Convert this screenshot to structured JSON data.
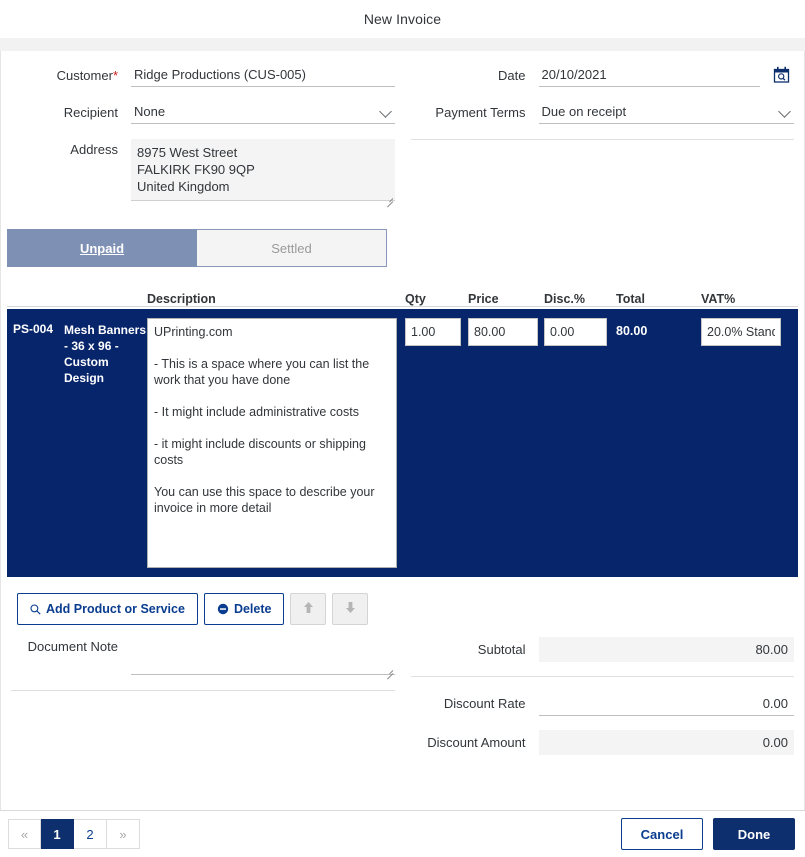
{
  "dialog": {
    "title": "New Invoice"
  },
  "form": {
    "customer": {
      "label": "Customer",
      "required_marker": "*",
      "value": "Ridge Productions (CUS-005)"
    },
    "recipient": {
      "label": "Recipient",
      "value": "None"
    },
    "address": {
      "label": "Address",
      "value": "8975 West Street\nFALKIRK FK90 9QP\nUnited Kingdom"
    },
    "date": {
      "label": "Date",
      "value": "20/10/2021",
      "icon": "calendar-icon"
    },
    "payment_terms": {
      "label": "Payment Terms",
      "value": "Due on receipt"
    }
  },
  "tabs": [
    {
      "label": "Unpaid",
      "active": true
    },
    {
      "label": "Settled",
      "active": false
    }
  ],
  "items_table": {
    "columns": [
      "",
      "",
      "Description",
      "Qty",
      "Price",
      "Disc.%",
      "Total",
      "VAT%"
    ],
    "headers": {
      "description": "Description",
      "qty": "Qty",
      "price": "Price",
      "disc": "Disc.%",
      "total": "Total",
      "vat": "VAT%"
    },
    "rows": [
      {
        "code": "PS-004",
        "name": "Mesh Banners - 36 x 96 - Custom Design",
        "description": "UPrinting.com\n\n- This is a space where you can list the work that you have done\n\n- It might include administrative costs\n\n- it might include discounts or shipping costs\n\nYou can use this space to describe your invoice in more detail",
        "qty": "1.00",
        "price": "80.00",
        "disc": "0.00",
        "total": "80.00",
        "vat": "20.0% Standa",
        "selected": true
      }
    ]
  },
  "row_actions": {
    "add": {
      "label": "Add Product or Service",
      "icon": "search-icon"
    },
    "delete": {
      "label": "Delete",
      "icon": "minus-circle-icon"
    },
    "move_up": {
      "icon": "arrow-up-icon"
    },
    "move_down": {
      "icon": "arrow-down-icon"
    }
  },
  "document_note": {
    "label": "Document Note",
    "value": ""
  },
  "totals": [
    {
      "label": "Subtotal",
      "value": "80.00",
      "readonly": true
    },
    {
      "label": "Discount Rate",
      "value": "0.00",
      "readonly": false
    },
    {
      "label": "Discount Amount",
      "value": "0.00",
      "readonly": true
    }
  ],
  "pagination": {
    "prev": "«",
    "next": "»",
    "pages": [
      "1",
      "2"
    ],
    "current": "1"
  },
  "footer": {
    "cancel_label": "Cancel",
    "done_label": "Done"
  },
  "colors": {
    "navy": "#07256b",
    "accent_blue": "#0a3d8f",
    "done_blue": "#0d2f6e",
    "tab_active": "#7f90b5",
    "required_red": "#cc1919"
  }
}
